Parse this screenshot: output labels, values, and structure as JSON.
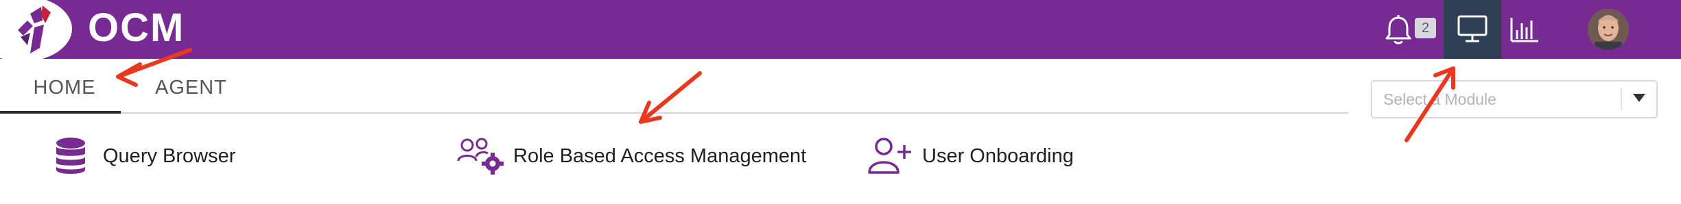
{
  "header": {
    "app_title": "OCM",
    "notification_count": "2",
    "brand_color": "#772a92",
    "active_icon_bg": "#2e3e55"
  },
  "icons": {
    "logo": "ocm-logo-icon",
    "notifications": "bell-icon",
    "monitor": "monitor-icon",
    "analytics": "bar-chart-icon",
    "profile": "avatar"
  },
  "tabs": [
    {
      "label": "HOME",
      "active": true
    },
    {
      "label": "AGENT",
      "active": false
    }
  ],
  "module_select": {
    "placeholder": "Select a Module",
    "selected": ""
  },
  "quick_links": [
    {
      "label": "Query Browser",
      "icon": "database-icon"
    },
    {
      "label": "Role Based Access Management",
      "icon": "users-gear-icon"
    },
    {
      "label": "User Onboarding",
      "icon": "user-plus-icon"
    }
  ],
  "annotation_color": "#e8391f"
}
